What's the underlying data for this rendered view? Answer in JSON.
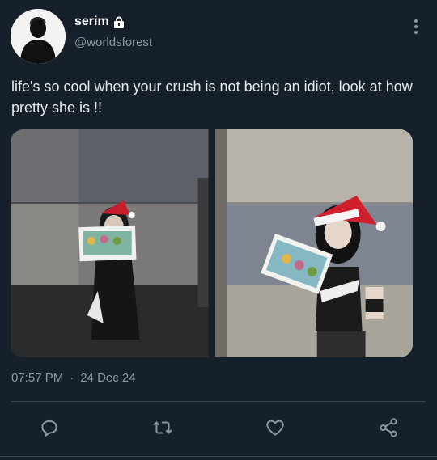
{
  "user": {
    "display_name": "serim",
    "handle": "@worldsforest",
    "protected_icon": "lock-icon",
    "avatar_icon": "avatar-silhouette"
  },
  "tweet": {
    "text": "life's so cool when your crush is not being an idiot, look at how pretty she is !!",
    "time": "07:57 PM",
    "separator": "·",
    "date": "24 Dec 24"
  },
  "media": [
    {
      "description_icon": "photo-1"
    },
    {
      "description_icon": "photo-2"
    }
  ],
  "actions": [
    {
      "icon": "reply-icon"
    },
    {
      "icon": "retweet-icon"
    },
    {
      "icon": "like-icon"
    },
    {
      "icon": "share-icon"
    }
  ],
  "colors": {
    "background": "#15202b",
    "text": "#e7e9ea",
    "secondary": "#8b98a5",
    "divider": "#38444d"
  }
}
